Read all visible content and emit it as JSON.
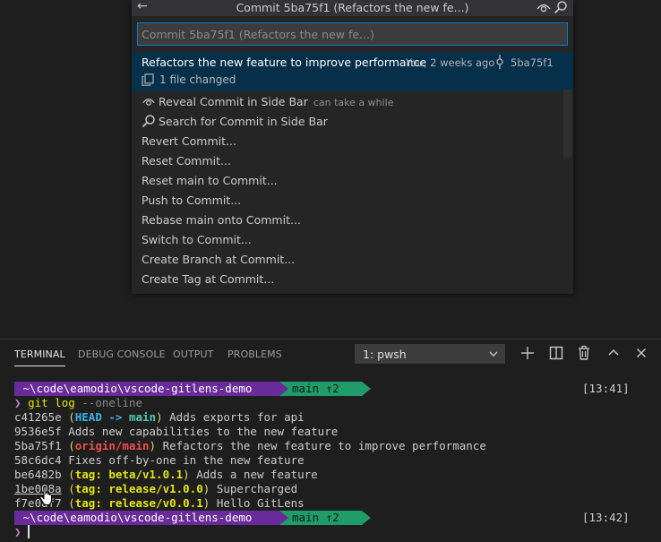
{
  "quick_pick": {
    "title": "Commit 5ba75f1 (Refactors the new fe...)",
    "input_placeholder": "Commit 5ba75f1 (Refactors the new fe...)",
    "selected": {
      "label": "Refactors the new feature to improve performance",
      "description": "You, 2 weeks ago",
      "sha": "5ba75f1",
      "detail": "1 file changed"
    },
    "items": [
      {
        "label": "Reveal Commit in Side Bar",
        "hint": "can take a while",
        "icon": "eye-icon"
      },
      {
        "label": "Search for Commit in Side Bar",
        "hint": "",
        "icon": "search-icon"
      },
      {
        "label": "Revert Commit...",
        "hint": "",
        "icon": ""
      },
      {
        "label": "Reset Commit...",
        "hint": "",
        "icon": ""
      },
      {
        "label": "Reset main to Commit...",
        "hint": "",
        "icon": ""
      },
      {
        "label": "Push to Commit...",
        "hint": "",
        "icon": ""
      },
      {
        "label": "Rebase main onto Commit...",
        "hint": "",
        "icon": ""
      },
      {
        "label": "Switch to Commit...",
        "hint": "",
        "icon": ""
      },
      {
        "label": "Create Branch at Commit...",
        "hint": "",
        "icon": ""
      },
      {
        "label": "Create Tag at Commit...",
        "hint": "",
        "icon": ""
      }
    ]
  },
  "panel": {
    "tabs": [
      "TERMINAL",
      "DEBUG CONSOLE",
      "OUTPUT",
      "PROBLEMS"
    ],
    "active_tab": "TERMINAL",
    "terminal_select": "1: pwsh",
    "actions": [
      "plus-icon",
      "split-icon",
      "trash-icon",
      "chevron-up-icon",
      "close-icon"
    ]
  },
  "terminal": {
    "prompt1": {
      "path": " ~\\code\\eamodio\\vscode-gitlens-demo",
      "branch": "main ↑2",
      "time": "[13:41]"
    },
    "command": {
      "caret": "❯",
      "cmd": "git log",
      "flag": "--oneline"
    },
    "log": [
      {
        "sha": "c41265e",
        "refs": [
          {
            "text": "HEAD",
            "kind": "head"
          },
          {
            "text": " -> ",
            "kind": "arrow"
          },
          {
            "text": "main",
            "kind": "branch"
          }
        ],
        "msg": "Adds exports for api"
      },
      {
        "sha": "9536e5f",
        "refs": [],
        "msg": "Adds new capabilities to the new feature"
      },
      {
        "sha": "5ba75f1",
        "refs": [
          {
            "text": "origin/main",
            "kind": "origin"
          }
        ],
        "msg": "Refactors the new feature to improve performance"
      },
      {
        "sha": "58c6dc4",
        "refs": [],
        "msg": "Fixes off-by-one in the new feature"
      },
      {
        "sha": "be6482b",
        "refs": [
          {
            "text": "tag: beta/v1.0.1",
            "kind": "tag"
          }
        ],
        "msg": "Adds a new feature"
      },
      {
        "sha": "1be008a",
        "refs": [
          {
            "text": "tag: release/v1.0.0",
            "kind": "tag"
          }
        ],
        "msg": "Supercharged"
      },
      {
        "sha": "f7e0af7",
        "refs": [
          {
            "text": "tag: release/v0.0.1",
            "kind": "tag"
          }
        ],
        "msg": "Hello GitLens"
      }
    ],
    "prompt2": {
      "path": " ~\\code\\eamodio\\vscode-gitlens-demo",
      "branch": "main ↑2",
      "time": "[13:42]"
    },
    "caret2": "❯"
  }
}
